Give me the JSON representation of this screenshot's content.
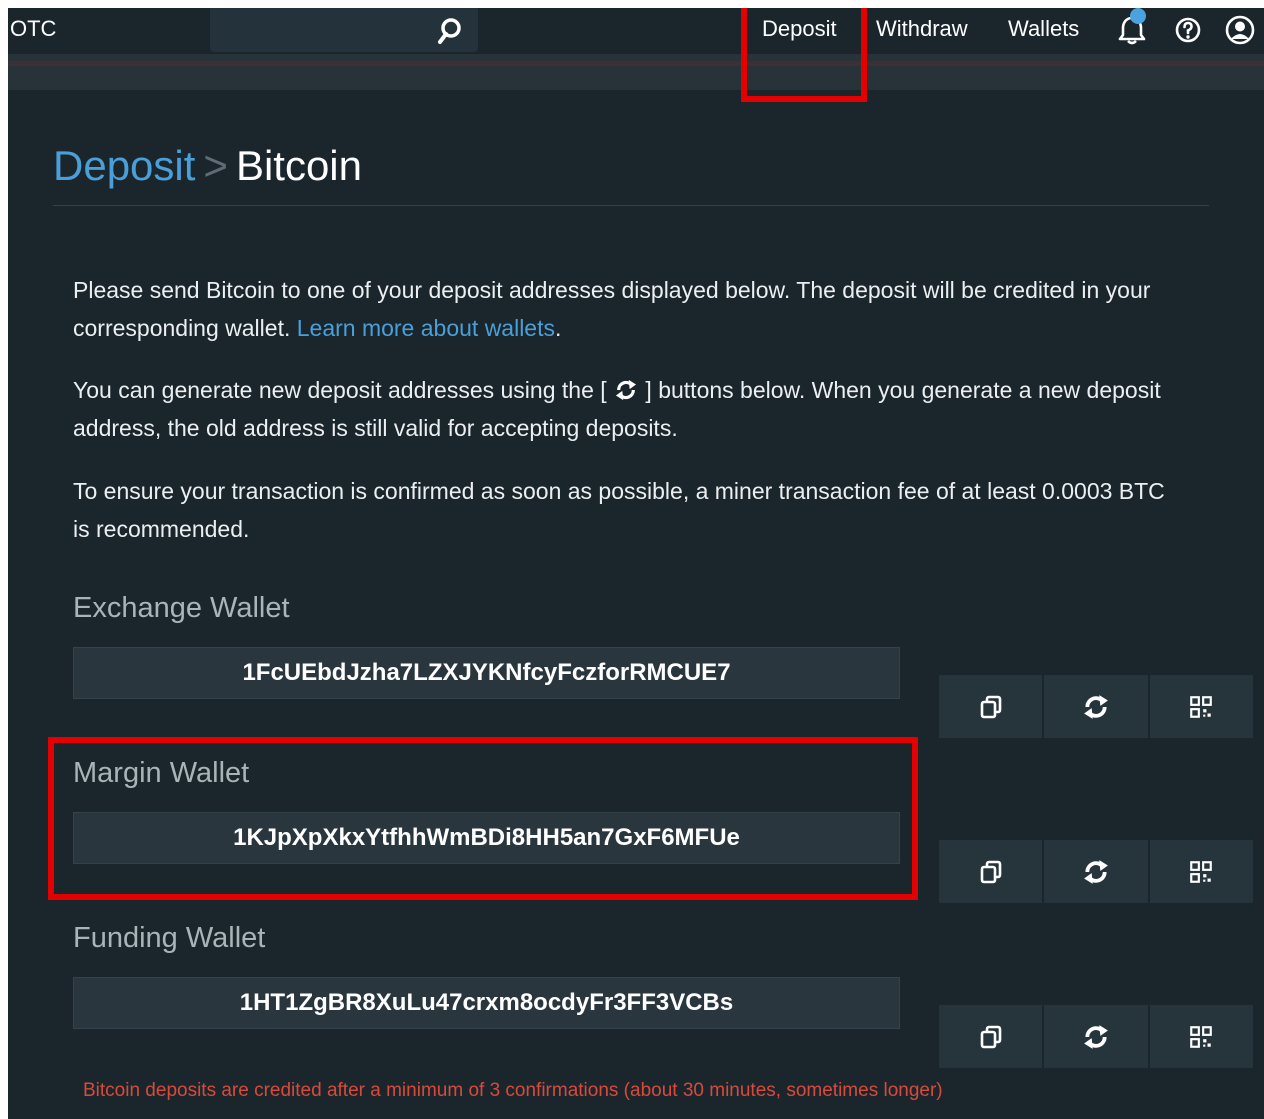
{
  "nav": {
    "brand": "OTC",
    "links": [
      {
        "label": "Deposit"
      },
      {
        "label": "Withdraw"
      },
      {
        "label": "Wallets"
      }
    ],
    "icons": [
      "search-icon",
      "bell-icon",
      "help-icon",
      "user-icon"
    ]
  },
  "title": {
    "crumb": "Deposit",
    "separator": ">",
    "current": "Bitcoin"
  },
  "intro": {
    "p1_text": "Please send Bitcoin to one of your deposit addresses displayed below. The deposit will be credited in your corresponding wallet.",
    "p1_link": "Learn more about wallets",
    "p1_end": ".",
    "p2_before": "You can generate new deposit addresses using the [",
    "p2_after": "] buttons below. When you generate a new deposit address, the old address is still valid for accepting deposits.",
    "p3": "To ensure your transaction is confirmed as soon as possible, a miner transaction fee of at least 0.0003 BTC is recommended."
  },
  "wallets": [
    {
      "label": "Exchange Wallet",
      "address": "1FcUEbdJzha7LZXJYKNfcyFczforRMCUE7"
    },
    {
      "label": "Margin Wallet",
      "address": "1KJpXpXkxYtfhhWmBDi8HH5an7GxF6MFUe"
    },
    {
      "label": "Funding Wallet",
      "address": "1HT1ZgBR8XuLu47crxm8ocdyFr3FF3VCBs"
    }
  ],
  "wallet_action_icons": [
    "copy-icon",
    "refresh-icon",
    "qr-code-icon"
  ],
  "footnote": "Bitcoin deposits are credited after a minimum of 3 confirmations (about 30 minutes, sometimes longer)",
  "colors": {
    "background": "#1b262c",
    "link": "#4a9fd8",
    "highlight": "#e40000",
    "footnote": "#d84a3b",
    "notification_dot": "#4aa3df"
  }
}
